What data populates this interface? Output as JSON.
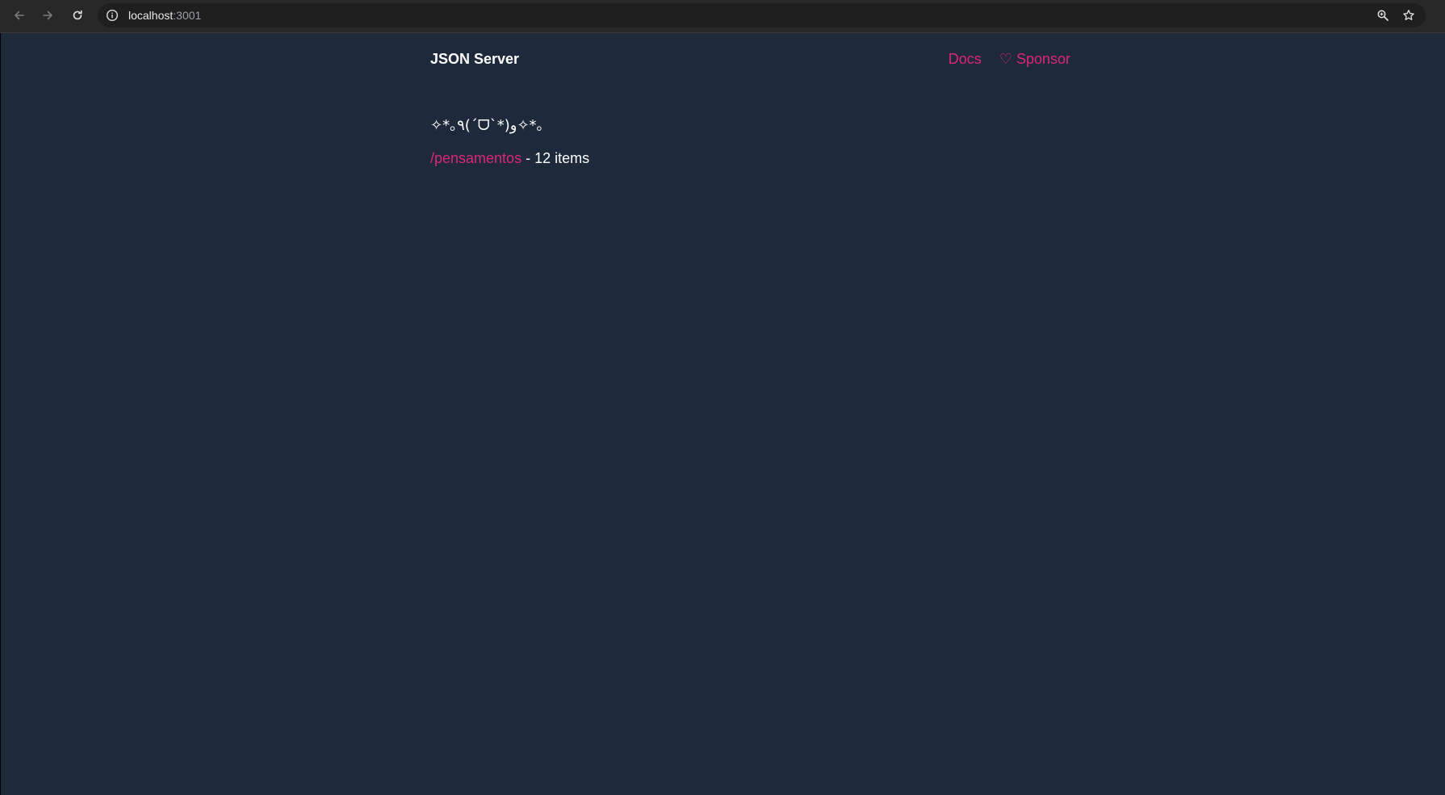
{
  "browser": {
    "url_host": "localhost",
    "url_port": ":3001",
    "back_icon": "arrow-left-icon",
    "forward_icon": "arrow-right-icon",
    "reload_icon": "reload-icon",
    "info_icon": "info-icon",
    "zoom_icon": "zoom-icon",
    "bookmark_icon": "star-icon"
  },
  "header": {
    "brand": "JSON Server",
    "links": [
      {
        "label": "Docs"
      },
      {
        "label": "♡ Sponsor"
      }
    ]
  },
  "main": {
    "kaomoji": "✧*｡٩(ˊᗜˋ*)و✧*｡",
    "resources": [
      {
        "path": "/pensamentos",
        "suffix": " - 12 items"
      }
    ]
  },
  "colors": {
    "background": "#1e293b",
    "accent": "#db2777",
    "text": "#ffffff"
  }
}
